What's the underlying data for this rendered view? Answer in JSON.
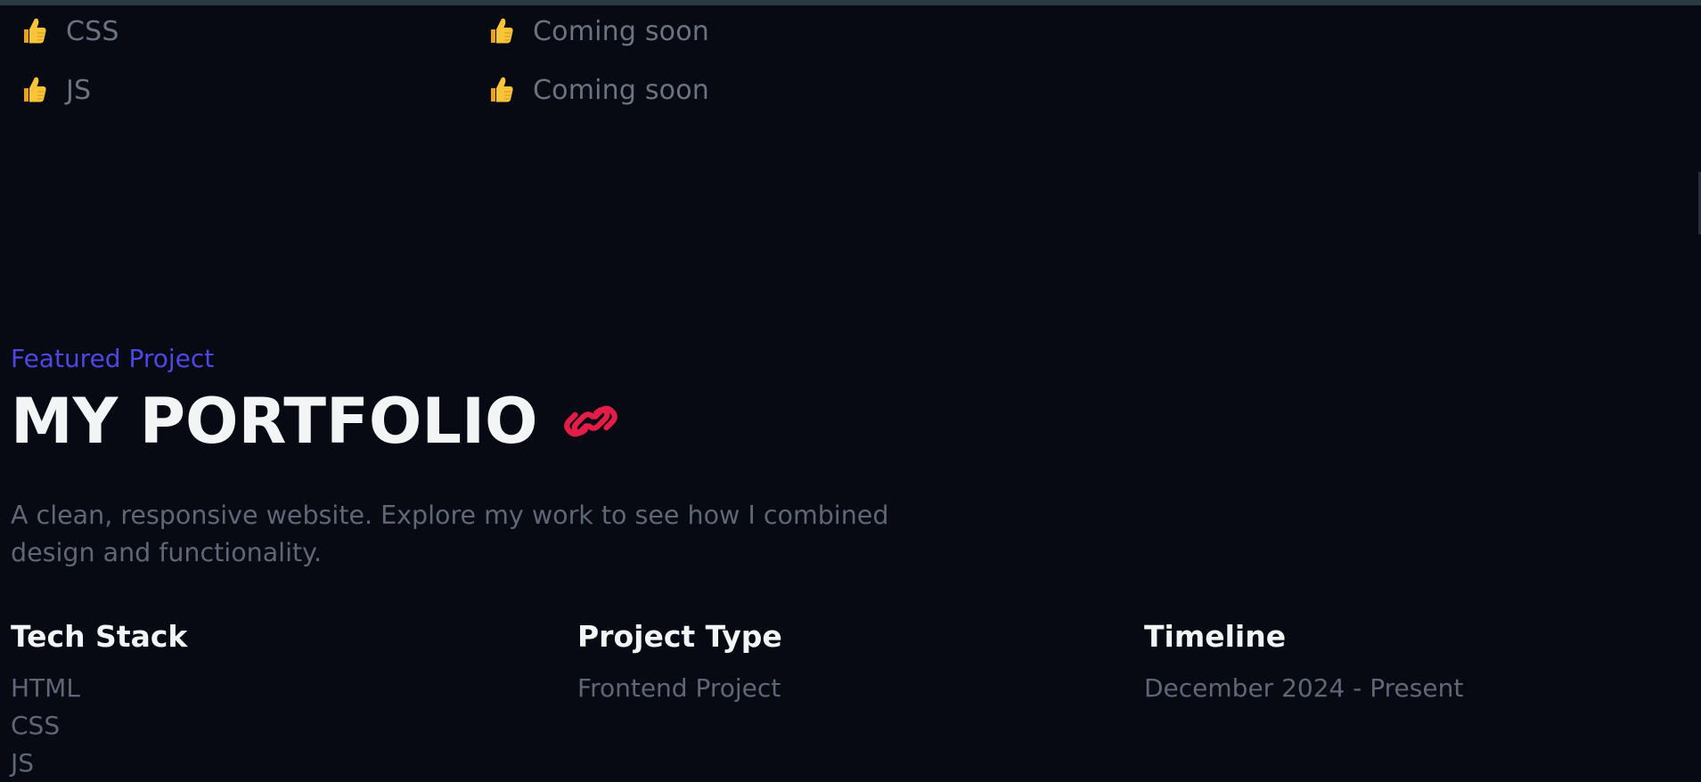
{
  "skills": {
    "rows": [
      {
        "skill": "CSS",
        "status": "Coming soon"
      },
      {
        "skill": "JS",
        "status": "Coming soon"
      }
    ],
    "icon": "thumbs-up-icon"
  },
  "project": {
    "eyebrow": "Featured Project",
    "title": "MY PORTFOLIO",
    "title_icon": "link-icon",
    "description": "A clean, responsive website. Explore my work to see how I combined design and functionality.",
    "columns": [
      {
        "heading": "Tech Stack",
        "items": [
          "HTML",
          "CSS",
          "JS"
        ]
      },
      {
        "heading": "Project Type",
        "items": [
          "Frontend Project"
        ]
      },
      {
        "heading": "Timeline",
        "items": [
          "December 2024 - Present"
        ]
      }
    ]
  },
  "colors": {
    "background": "#070a13",
    "accent": "#4f46e5",
    "link_icon": "#e11d48",
    "thumb": "#f5b82e"
  }
}
